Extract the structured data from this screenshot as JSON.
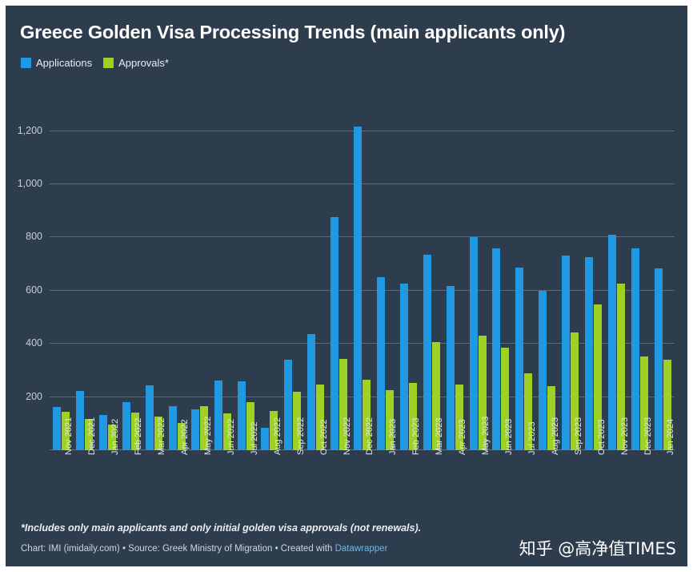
{
  "chart": {
    "title": "Greece Golden Visa Processing Trends (main applicants only)",
    "footnote": "*Includes only main applicants and only initial golden visa approvals (not renewals).",
    "credit_prefix": "Chart: IMI (imidaily.com) • Source: Greek Ministry of Migration • Created with ",
    "credit_link": "Datawrapper",
    "background_color": "#2e3d4d"
  },
  "legend": {
    "position": "top-left",
    "items": [
      {
        "label": "Applications",
        "color": "#1f9ae2"
      },
      {
        "label": "Approvals*",
        "color": "#9fd124"
      }
    ]
  },
  "watermark": {
    "text": "知乎 @高净值TIMES"
  },
  "chart_data": {
    "type": "bar",
    "title": "Greece Golden Visa Processing Trends (main applicants only)",
    "xlabel": "",
    "ylabel": "",
    "ylim": [
      0,
      1280
    ],
    "grid": true,
    "legend_position": "top-left",
    "ytick_labels": [
      "200",
      "400",
      "600",
      "800",
      "1,000",
      "1,200"
    ],
    "yticks": [
      200,
      400,
      600,
      800,
      1000,
      1200
    ],
    "categories": [
      "Nov 2021",
      "Dec 2021",
      "Jan 2022",
      "Feb 2022",
      "Mar 2022",
      "Apr 2022",
      "May 2022",
      "Jun 2022",
      "Jul 2022",
      "Aug 2022",
      "Sep 2022",
      "Oct 2022",
      "Nov 2022",
      "Dec 2022",
      "Jan 2023",
      "Feb 2023",
      "Mar 2023",
      "Apr 2023",
      "May 2023",
      "Jun 2023",
      "Jul 2023",
      "Aug 2023",
      "Sep 2023",
      "Oct 2023",
      "Nov 2023",
      "Dec 2023",
      "Jan 2024"
    ],
    "series": [
      {
        "name": "Applications",
        "color": "#1f9ae2",
        "values": [
          163,
          222,
          133,
          182,
          243,
          165,
          155,
          262,
          260,
          85,
          340,
          437,
          875,
          1218,
          650,
          625,
          735,
          618,
          802,
          760,
          688,
          600,
          733,
          727,
          810,
          760,
          685
        ]
      },
      {
        "name": "Approvals*",
        "color": "#9fd124",
        "values": [
          146,
          118,
          95,
          142,
          128,
          103,
          166,
          140,
          180,
          148,
          220,
          247,
          342,
          265,
          225,
          253,
          408,
          247,
          432,
          387,
          290,
          240,
          443,
          548,
          625,
          353,
          341
        ]
      }
    ]
  }
}
